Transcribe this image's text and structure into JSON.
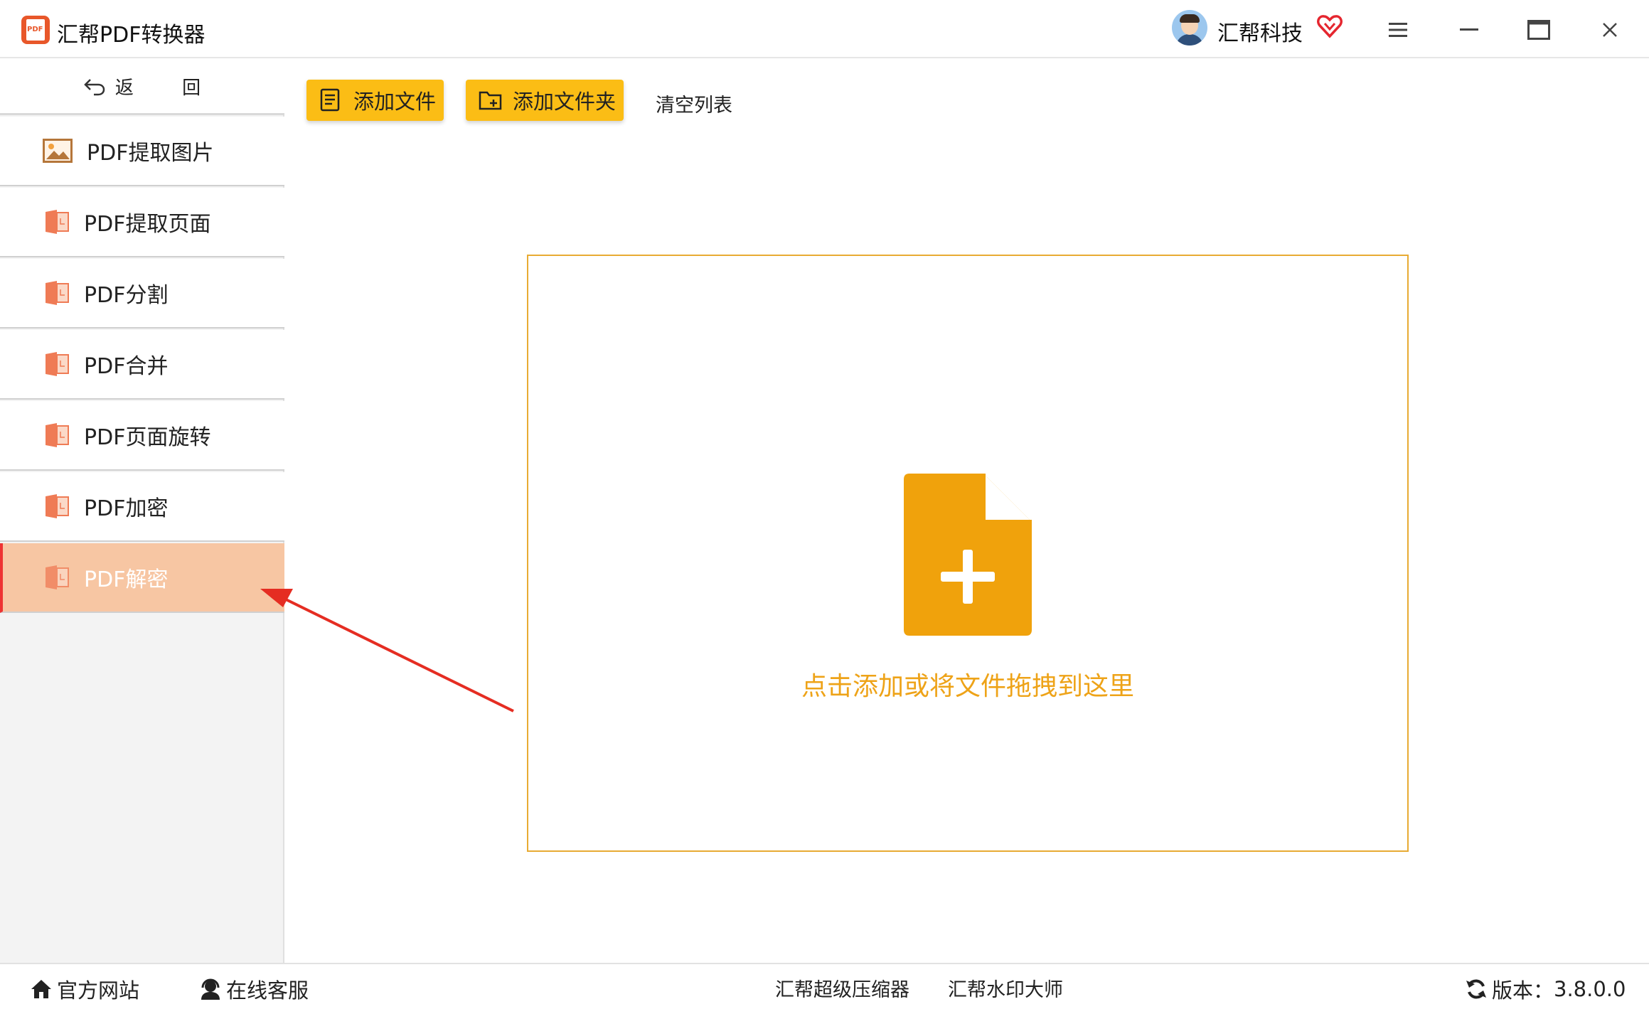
{
  "app": {
    "title": "汇帮PDF转换器",
    "logo_text": "PDF"
  },
  "user": {
    "name": "汇帮科技"
  },
  "window_controls": [
    "menu-icon",
    "minimize-icon",
    "maximize-icon",
    "close-icon"
  ],
  "sidebar": {
    "back_label": "返 回",
    "items": [
      {
        "label": "PDF提取图片",
        "icon": "image-icon",
        "active": false
      },
      {
        "label": "PDF提取页面",
        "icon": "pdf-file-icon",
        "active": false
      },
      {
        "label": "PDF分割",
        "icon": "pdf-file-icon",
        "active": false
      },
      {
        "label": "PDF合并",
        "icon": "pdf-file-icon",
        "active": false
      },
      {
        "label": "PDF页面旋转",
        "icon": "pdf-file-icon",
        "active": false
      },
      {
        "label": "PDF加密",
        "icon": "pdf-file-icon",
        "active": false
      },
      {
        "label": "PDF解密",
        "icon": "pdf-file-icon",
        "active": true
      }
    ]
  },
  "toolbar": {
    "add_file_label": "添加文件",
    "add_folder_label": "添加文件夹",
    "clear_list_label": "清空列表"
  },
  "dropzone": {
    "hint": "点击添加或将文件拖拽到这里"
  },
  "statusbar": {
    "official_site": "官方网站",
    "online_service": "在线客服",
    "compressor": "汇帮超级压缩器",
    "watermark": "汇帮水印大师",
    "version_label": "版本：",
    "version_value": "3.8.0.0"
  },
  "colors": {
    "accent_yellow": "#fbbd15",
    "dropzone_border": "#e8ab33",
    "hint_orange": "#eea318",
    "active_item_bg": "#f7c6a3",
    "pdf_icon": "#ef7b55",
    "arrow_red": "#e52d22"
  }
}
